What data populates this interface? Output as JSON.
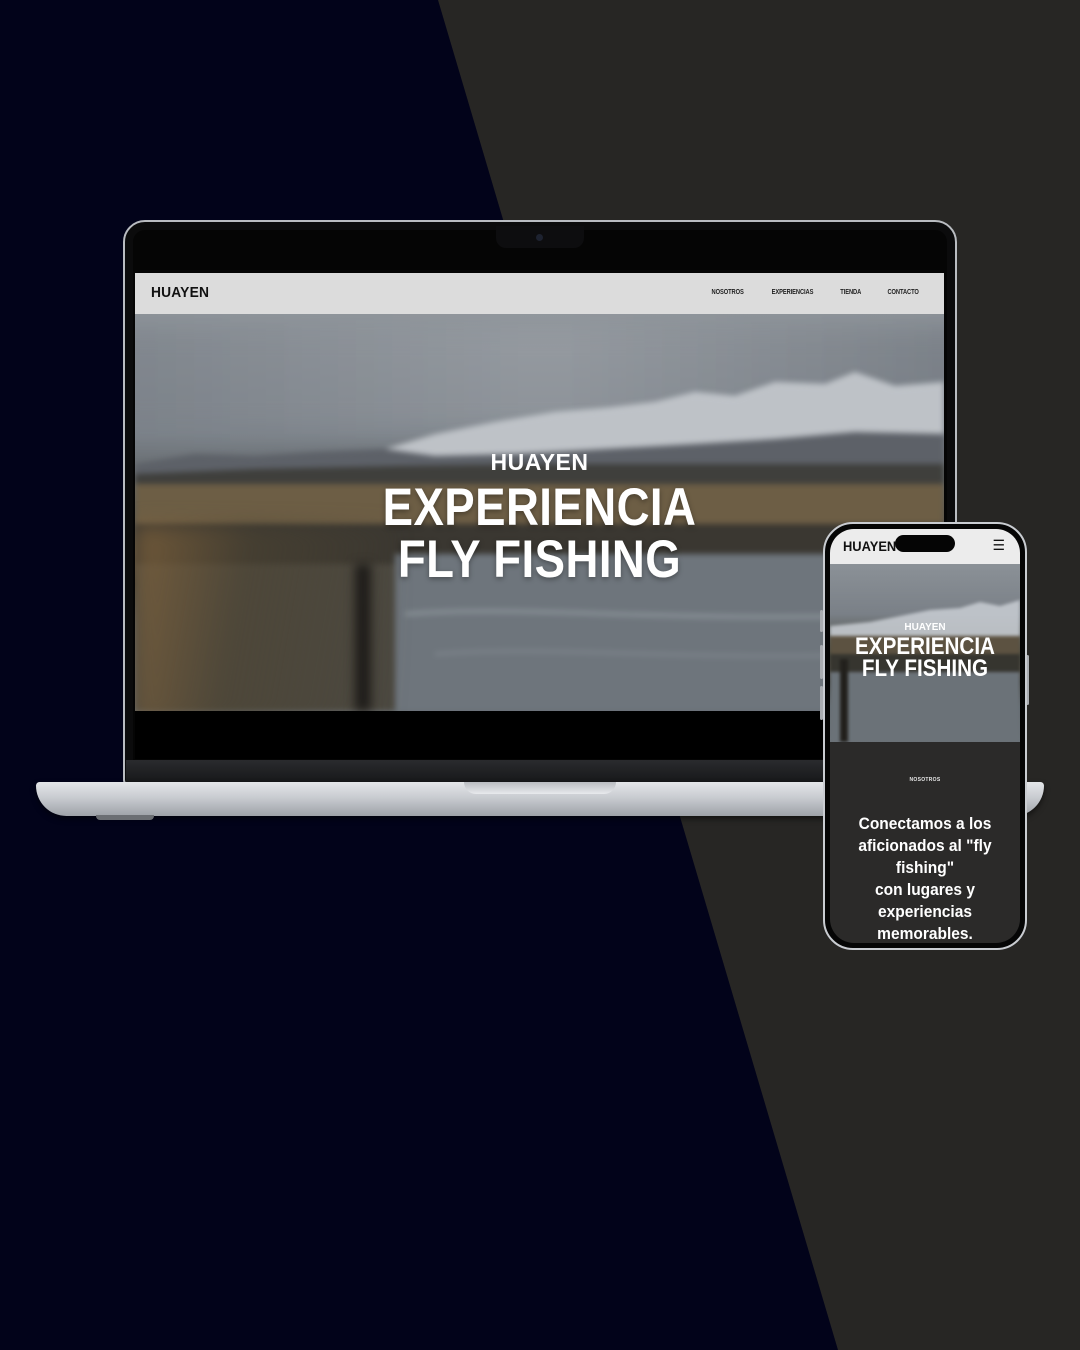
{
  "colors": {
    "background_left": "#02031a",
    "background_right": "#272624",
    "desktop_nav_bg": "#dcdcdc",
    "mobile_section_bg": "#2b2a29",
    "hero_text": "#ffffff"
  },
  "desktop": {
    "logo": "HUAYEN",
    "nav": [
      "NOSOTROS",
      "EXPERIENCIAS",
      "TIENDA",
      "CONTACTO"
    ],
    "hero": {
      "brand": "HUAYEN",
      "title_line1": "EXPERIENCIA",
      "title_line2": "FLY FISHING"
    }
  },
  "mobile": {
    "logo": "HUAYEN",
    "menu_icon": "hamburger-icon",
    "hero": {
      "brand": "HUAYEN",
      "title_line1": "EXPERIENCIA",
      "title_line2": "FLY FISHING"
    },
    "section_label": "NOSOTROS",
    "section_body": "Conectamos a los\naficionados al \"fly\nfishing\"\ncon lugares y\nexperiencias\nmemorables."
  }
}
